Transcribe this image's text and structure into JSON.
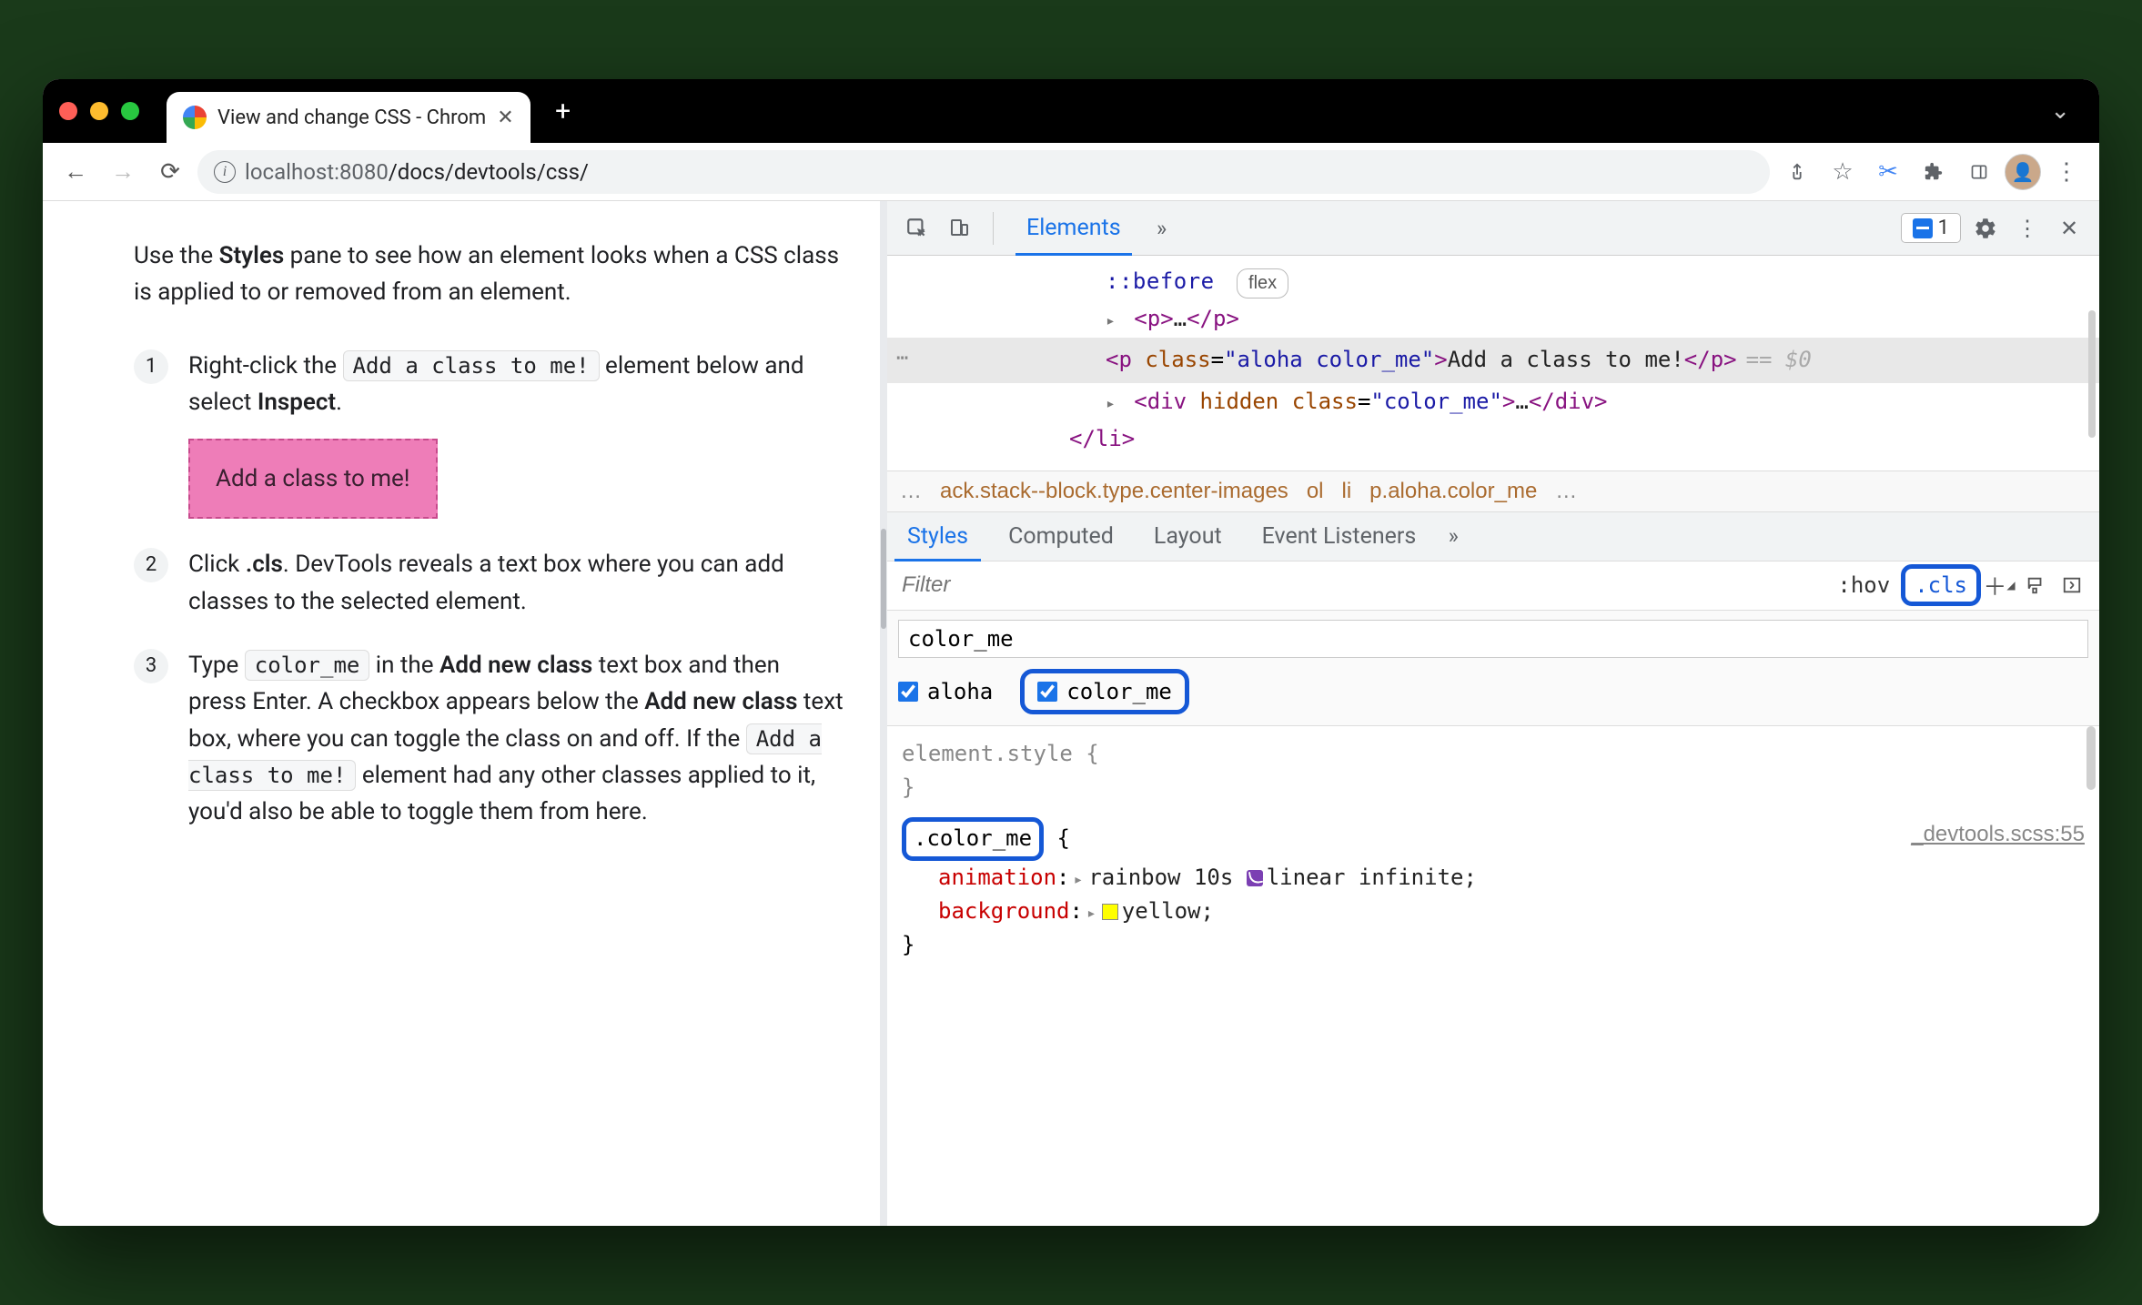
{
  "window": {
    "tab_title": "View and change CSS - Chrom",
    "url_display": {
      "host": "localhost",
      "port": ":8080",
      "path": "/docs/devtools/css/"
    }
  },
  "page": {
    "intro_prefix": "Use the ",
    "intro_bold": "Styles",
    "intro_suffix": " pane to see how an element looks when a CSS class is applied to or removed from an element.",
    "steps": [
      {
        "pre": "Right-click the ",
        "code": "Add a class to me!",
        "mid": " element below and select ",
        "bold": "Inspect",
        "post": ".",
        "pinkbox": "Add a class to me!"
      },
      {
        "pre": "Click ",
        "bold": ".cls",
        "post": ". DevTools reveals a text box where you can add classes to the selected element."
      },
      {
        "pre": "Type ",
        "code": "color_me",
        "mid": " in the ",
        "bold": "Add new class",
        "mid2": " text box and then press Enter. A checkbox appears below the ",
        "bold2": "Add new class",
        "mid3": " text box, where you can toggle the class on and off. If the ",
        "code2": "Add a class to me!",
        "post": " element had any other classes applied to it, you'd also be able to toggle them from here."
      }
    ]
  },
  "devtools": {
    "tabs_main": "Elements",
    "issues_count": "1",
    "dom": {
      "before": "::before",
      "flex_badge": "flex",
      "p_collapsed": "<p>…</p>",
      "sel_open": "<p class=\"aloha color_me\">",
      "sel_text": "Add a class to me!",
      "sel_close": "</p>",
      "eq0": "== $0",
      "div_hidden": "<div hidden class=\"color_me\">…</div>",
      "li_close": "</li>"
    },
    "crumbs": {
      "ellipsis": "…",
      "c1": "ack.stack--block.type.center-images",
      "c2": "ol",
      "c3": "li",
      "c4": "p.aloha.color_me",
      "end": "…"
    },
    "styles_tabs": [
      "Styles",
      "Computed",
      "Layout",
      "Event Listeners"
    ],
    "filter_placeholder": "Filter",
    "hov_label": ":hov",
    "cls_label": ".cls",
    "class_input_value": "color_me",
    "checks": [
      {
        "label": "aloha",
        "checked": true,
        "highlighted": false
      },
      {
        "label": "color_me",
        "checked": true,
        "highlighted": true
      }
    ],
    "rules": {
      "element_style": "element.style {",
      "element_close": "}",
      "color_me_sel": ".color_me",
      "brace_open": " {",
      "src": "_devtools.scss:55",
      "anim_prop": "animation",
      "anim_val": "rainbow 10s ",
      "anim_val2": "linear infinite;",
      "bg_prop": "background",
      "bg_val": "yellow;",
      "brace_close": "}"
    }
  }
}
